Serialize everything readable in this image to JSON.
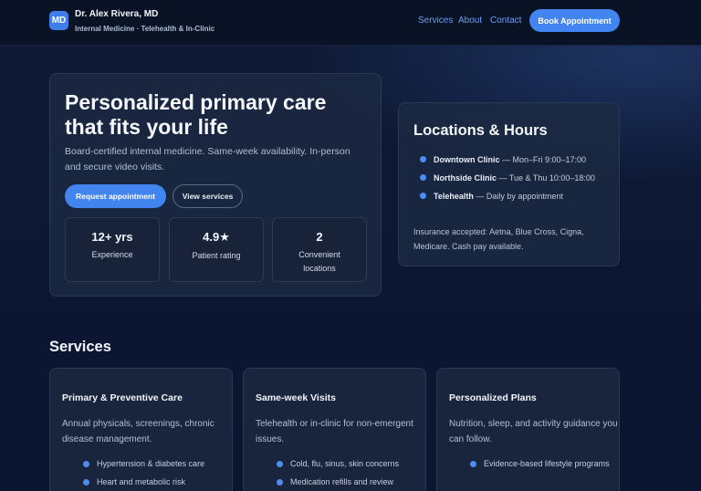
{
  "header": {
    "logo_text": "MD",
    "name": "Dr. Alex Rivera, MD",
    "subtitle": "Internal Medicine · Telehealth & In-Clinic",
    "nav": [
      "Services",
      "About",
      "Contact"
    ],
    "book_label": "Book Appointment"
  },
  "hero": {
    "title": "Personalized primary care that fits your life",
    "description": "Board-certified internal medicine. Same-week availability. In-person and secure video visits.",
    "primary_cta": "Request appointment",
    "secondary_cta": "View services",
    "stats": [
      {
        "value": "12+ yrs",
        "label": "Experience"
      },
      {
        "value": "4.9★",
        "label": "Patient rating"
      },
      {
        "value": "2",
        "label": "Convenient locations"
      }
    ]
  },
  "locations": {
    "title": "Locations & Hours",
    "items": [
      {
        "name": "Downtown Clinic",
        "detail": " — Mon–Fri 9:00–17:00"
      },
      {
        "name": "Northside Clinic",
        "detail": " — Tue & Thu 10:00–18:00"
      },
      {
        "name": "Telehealth",
        "detail": " — Daily by appointment"
      }
    ],
    "insurance": "Insurance accepted: Aetna, Blue Cross, Cigna, Medicare. Cash pay available."
  },
  "services": {
    "heading": "Services",
    "cards": [
      {
        "title": "Primary & Preventive Care",
        "description": "Annual physicals, screenings, chronic disease management.",
        "bullets": [
          "Hypertension & diabetes care",
          "Heart and metabolic risk"
        ]
      },
      {
        "title": "Same-week Visits",
        "description": "Telehealth or in-clinic for non-emergent issues.",
        "bullets": [
          "Cold, flu, sinus, skin concerns",
          "Medication refills and review"
        ]
      },
      {
        "title": "Personalized Plans",
        "description": "Nutrition, sleep, and activity guidance you can follow.",
        "bullets": [
          "Evidence-based lifestyle programs"
        ]
      }
    ]
  },
  "colors": {
    "accent": "#4285f0",
    "background": "#0b1630",
    "card": "#1e2a42"
  }
}
